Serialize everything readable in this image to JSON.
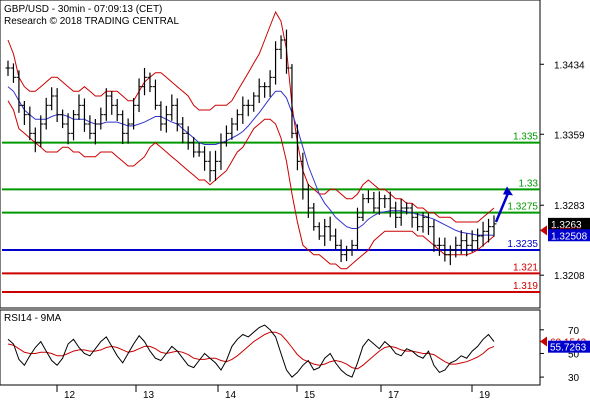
{
  "header": {
    "line1": "GBP/USD - 30min - 07:09:13 (CET)",
    "line2": "Research © 2018 TRADING CENTRAL"
  },
  "rsi_panel": {
    "label": "RSI14 - 9MA"
  },
  "colors": {
    "support": "#0000cc",
    "resistance": "#009900",
    "low_support": "#cc0000",
    "bands": "#cc0000",
    "ma": "#3333cc",
    "arrow": "#0000cc",
    "price_badge": "#000000",
    "ma_badge": "#0000cc"
  },
  "chart_data": [
    {
      "type": "candlestick",
      "symbol": "GBP/USD",
      "timeframe": "30min",
      "ylim": [
        1.3175,
        1.3475
      ],
      "y_ticks": [
        "1.3434",
        "1.3359",
        "1.3283",
        "1.3208"
      ],
      "x_ticks": [
        "12",
        "13",
        "14",
        "15",
        "16",
        "17",
        "19"
      ],
      "levels": [
        {
          "value": 1.335,
          "label": "1.335",
          "role": "resistance",
          "color": "#009900"
        },
        {
          "value": 1.33,
          "label": "1.33",
          "role": "resistance",
          "color": "#009900"
        },
        {
          "value": 1.3275,
          "label": "1.3275",
          "role": "pivot",
          "color": "#009900"
        },
        {
          "value": 1.3235,
          "label": "1.3235",
          "role": "support",
          "color": "#0000cc"
        },
        {
          "value": 1.321,
          "label": "1.321",
          "role": "support",
          "color": "#cc0000"
        },
        {
          "value": 1.319,
          "label": "1.319",
          "role": "support",
          "color": "#cc0000"
        }
      ],
      "badges": [
        {
          "value": 1.3263,
          "label": "1.3263",
          "kind": "last-price"
        },
        {
          "value": 1.3256,
          "label": "1.3256",
          "kind": "upper-band"
        },
        {
          "value": 1.32508,
          "label": "1.32508",
          "kind": "moving-average"
        }
      ],
      "close_path": [
        1.343,
        1.342,
        1.339,
        1.338,
        1.336,
        1.335,
        1.337,
        1.339,
        1.34,
        1.338,
        1.337,
        1.336,
        1.338,
        1.339,
        1.337,
        1.336,
        1.337,
        1.338,
        1.34,
        1.339,
        1.338,
        1.336,
        1.337,
        1.339,
        1.341,
        1.342,
        1.341,
        1.339,
        1.337,
        1.338,
        1.339,
        1.337,
        1.336,
        1.335,
        1.334,
        1.334,
        1.333,
        1.332,
        1.333,
        1.335,
        1.336,
        1.337,
        1.338,
        1.339,
        1.339,
        1.34,
        1.341,
        1.341,
        1.342,
        1.345,
        1.346,
        1.343,
        1.336,
        1.333,
        1.33,
        1.328,
        1.326,
        1.325,
        1.326,
        1.325,
        1.324,
        1.323,
        1.3235,
        1.324,
        1.327,
        1.329,
        1.329,
        1.328,
        1.329,
        1.329,
        1.328,
        1.327,
        1.328,
        1.328,
        1.327,
        1.326,
        1.327,
        1.326,
        1.324,
        1.324,
        1.323,
        1.3235,
        1.324,
        1.3245,
        1.324,
        1.3245,
        1.325,
        1.3255,
        1.326,
        1.3263
      ],
      "upper_band": [
        1.346,
        1.3445,
        1.342,
        1.341,
        1.3405,
        1.3405,
        1.341,
        1.3415,
        1.342,
        1.342,
        1.3415,
        1.341,
        1.3405,
        1.3405,
        1.341,
        1.3405,
        1.34,
        1.34,
        1.3405,
        1.3405,
        1.3405,
        1.34,
        1.3395,
        1.3395,
        1.3405,
        1.3415,
        1.342,
        1.3425,
        1.3425,
        1.342,
        1.3415,
        1.341,
        1.3405,
        1.34,
        1.339,
        1.3385,
        1.3385,
        1.3385,
        1.339,
        1.339,
        1.339,
        1.3395,
        1.3405,
        1.3415,
        1.3425,
        1.3435,
        1.3445,
        1.346,
        1.3475,
        1.349,
        1.348,
        1.345,
        1.339,
        1.335,
        1.332,
        1.3305,
        1.33,
        1.3295,
        1.3295,
        1.33,
        1.33,
        1.3295,
        1.329,
        1.329,
        1.3295,
        1.3305,
        1.331,
        1.3305,
        1.33,
        1.33,
        1.3295,
        1.329,
        1.329,
        1.3285,
        1.3285,
        1.328,
        1.328,
        1.3275,
        1.3275,
        1.327,
        1.327,
        1.327,
        1.3265,
        1.3265,
        1.3265,
        1.3265,
        1.3265,
        1.327,
        1.3275,
        1.328
      ],
      "lower_band": [
        1.3395,
        1.3385,
        1.3365,
        1.336,
        1.3355,
        1.335,
        1.3345,
        1.334,
        1.334,
        1.334,
        1.3345,
        1.3345,
        1.334,
        1.334,
        1.3335,
        1.3335,
        1.3335,
        1.334,
        1.334,
        1.334,
        1.3335,
        1.333,
        1.3325,
        1.3325,
        1.333,
        1.3335,
        1.3345,
        1.335,
        1.3345,
        1.334,
        1.3335,
        1.333,
        1.3325,
        1.332,
        1.3315,
        1.331,
        1.331,
        1.3305,
        1.331,
        1.3315,
        1.332,
        1.333,
        1.334,
        1.3345,
        1.3355,
        1.3365,
        1.337,
        1.3375,
        1.3375,
        1.337,
        1.3355,
        1.333,
        1.3295,
        1.3265,
        1.324,
        1.3235,
        1.323,
        1.323,
        1.3225,
        1.322,
        1.322,
        1.3215,
        1.3215,
        1.322,
        1.3225,
        1.323,
        1.3235,
        1.3245,
        1.325,
        1.3255,
        1.3255,
        1.3255,
        1.3255,
        1.3255,
        1.3255,
        1.325,
        1.325,
        1.3245,
        1.324,
        1.3235,
        1.323,
        1.323,
        1.323,
        1.323,
        1.323,
        1.3232,
        1.3235,
        1.324,
        1.3245,
        1.325
      ],
      "moving_average": [
        1.341,
        1.3405,
        1.3395,
        1.3385,
        1.338,
        1.3375,
        1.3375,
        1.3375,
        1.3378,
        1.338,
        1.338,
        1.3378,
        1.3375,
        1.3375,
        1.3375,
        1.3372,
        1.337,
        1.337,
        1.3372,
        1.3372,
        1.3372,
        1.337,
        1.3368,
        1.3368,
        1.337,
        1.3372,
        1.3375,
        1.3378,
        1.3378,
        1.3375,
        1.3372,
        1.337,
        1.3365,
        1.336,
        1.3355,
        1.335,
        1.3348,
        1.3348,
        1.3348,
        1.335,
        1.3352,
        1.3355,
        1.3358,
        1.3362,
        1.3368,
        1.3375,
        1.3382,
        1.339,
        1.3398,
        1.3405,
        1.3405,
        1.3398,
        1.3382,
        1.3365,
        1.3345,
        1.3325,
        1.331,
        1.3295,
        1.3285,
        1.3278,
        1.327,
        1.3265,
        1.326,
        1.3258,
        1.3258,
        1.3262,
        1.3268,
        1.3272,
        1.3275,
        1.3276,
        1.3277,
        1.3277,
        1.3277,
        1.3276,
        1.3275,
        1.3273,
        1.3272,
        1.327,
        1.3268,
        1.3265,
        1.3262,
        1.3259,
        1.3256,
        1.3254,
        1.3253,
        1.3252,
        1.3251,
        1.3251,
        1.3251,
        1.32508
      ],
      "target_arrow": {
        "from": 1.3265,
        "to": 1.33
      }
    },
    {
      "type": "line",
      "name": "RSI14 - 9MA",
      "ylim": [
        25,
        80
      ],
      "y_ticks": [
        "70",
        "50",
        "30"
      ],
      "badges": [
        {
          "value": 60.1542,
          "label": "60.1542",
          "kind": "rsi"
        },
        {
          "value": 55.7263,
          "label": "55.7263",
          "kind": "rsi-ma"
        }
      ],
      "rsi": [
        62,
        58,
        45,
        40,
        48,
        55,
        60,
        52,
        44,
        40,
        46,
        58,
        62,
        55,
        50,
        48,
        54,
        60,
        64,
        56,
        48,
        42,
        50,
        58,
        65,
        60,
        52,
        46,
        44,
        50,
        56,
        52,
        46,
        40,
        38,
        44,
        50,
        46,
        42,
        36,
        44,
        56,
        62,
        66,
        64,
        68,
        72,
        74,
        70,
        64,
        50,
        36,
        30,
        34,
        40,
        44,
        36,
        38,
        46,
        50,
        42,
        36,
        32,
        30,
        42,
        56,
        62,
        58,
        54,
        60,
        56,
        50,
        48,
        54,
        52,
        48,
        46,
        52,
        40,
        34,
        36,
        42,
        44,
        48,
        46,
        52,
        56,
        62,
        66,
        60
      ],
      "rsi_ma": [
        58,
        57,
        54,
        51,
        50,
        50,
        51,
        51,
        50,
        48,
        48,
        50,
        52,
        53,
        53,
        52,
        52,
        53,
        55,
        56,
        55,
        53,
        51,
        52,
        54,
        56,
        56,
        54,
        51,
        50,
        51,
        52,
        51,
        49,
        46,
        45,
        45,
        46,
        46,
        44,
        43,
        45,
        48,
        52,
        56,
        60,
        63,
        66,
        68,
        68,
        66,
        61,
        55,
        49,
        45,
        43,
        41,
        40,
        41,
        43,
        44,
        43,
        41,
        38,
        37,
        40,
        44,
        48,
        52,
        55,
        56,
        55,
        53,
        52,
        52,
        51,
        50,
        50,
        49,
        46,
        43,
        41,
        41,
        42,
        43,
        45,
        47,
        50,
        54,
        56
      ]
    }
  ]
}
